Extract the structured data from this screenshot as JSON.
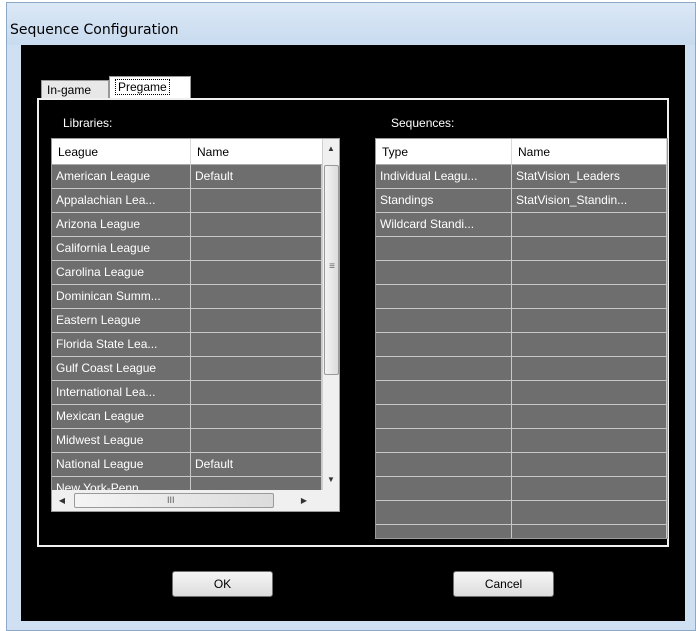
{
  "window": {
    "title": "Sequence Configuration"
  },
  "tabs": [
    {
      "label": "In-game",
      "selected": false
    },
    {
      "label": "Pregame",
      "selected": true
    }
  ],
  "libraries": {
    "label": "Libraries:",
    "columns": [
      "League",
      "Name"
    ],
    "rows": [
      [
        "American League",
        "Default"
      ],
      [
        "Appalachian Lea...",
        ""
      ],
      [
        "Arizona League",
        ""
      ],
      [
        "California League",
        ""
      ],
      [
        "Carolina League",
        ""
      ],
      [
        "Dominican Summ...",
        ""
      ],
      [
        "Eastern League",
        ""
      ],
      [
        "Florida State Lea...",
        ""
      ],
      [
        "Gulf Coast League",
        ""
      ],
      [
        "International Lea...",
        ""
      ],
      [
        "Mexican League",
        ""
      ],
      [
        "Midwest League",
        ""
      ],
      [
        "National League",
        "Default"
      ],
      [
        "New York-Penn ...",
        ""
      ],
      [
        "",
        ""
      ]
    ],
    "scroll_glyphs": {
      "up": "▲",
      "down": "▼",
      "left": "◀",
      "right": "▶",
      "grip": "≡",
      "hgrip": "III"
    }
  },
  "sequences": {
    "label": "Sequences:",
    "columns": [
      "Type",
      "Name"
    ],
    "rows": [
      [
        "Individual Leagu...",
        "StatVision_Leaders"
      ],
      [
        "Standings",
        "StatVision_Standin..."
      ],
      [
        "Wildcard Standi...",
        ""
      ],
      [
        "",
        ""
      ],
      [
        "",
        ""
      ],
      [
        "",
        ""
      ],
      [
        "",
        ""
      ],
      [
        "",
        ""
      ],
      [
        "",
        ""
      ],
      [
        "",
        ""
      ],
      [
        "",
        ""
      ],
      [
        "",
        ""
      ],
      [
        "",
        ""
      ],
      [
        "",
        ""
      ],
      [
        "",
        ""
      ],
      [
        "",
        ""
      ]
    ]
  },
  "buttons": {
    "ok": "OK",
    "cancel": "Cancel"
  }
}
